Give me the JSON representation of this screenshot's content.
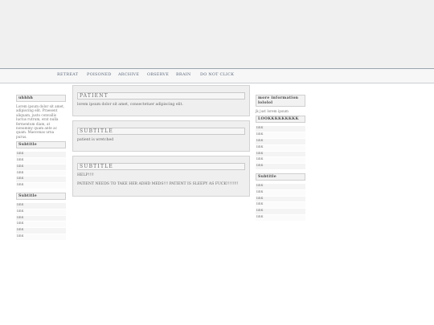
{
  "nav": {
    "items": [
      "RETREAT",
      "POISONED",
      "ARCHIVE",
      "OBSERVE",
      "BRAIN",
      "DO NOT CLICK"
    ]
  },
  "left_sidebar": {
    "block1_title": "uhhhh",
    "block1_text": "Lorem ipsum dolor sit amet, adipiscing elit. Praesent aliquam, justo convallis luctus rutrum, erat nulla fermentum diam, at nonummy quam ante ac quam. Maecenas urna purus.",
    "block2_title": "Subtitle",
    "block2_links": [
      "link",
      "link",
      "link",
      "link",
      "link",
      "link"
    ],
    "block3_title": "Subtitle",
    "block3_links": [
      "link",
      "link",
      "link",
      "link",
      "link",
      "link"
    ]
  },
  "posts": [
    {
      "title": "PATIENT",
      "lines": [
        "lorem ipsum dolor sit amet, consectetuer adipiscing elit."
      ]
    },
    {
      "title": "SUBTITLE",
      "lines": [
        "patient is wretched"
      ]
    },
    {
      "title": "SUBTITLE",
      "lines": [
        "HELP!!!!",
        "PATIENT NEEDS TO TAKE HER ADHD MEDS!!! PATIENT IS SLEEPY AS FUCK!!!!!!!!"
      ]
    }
  ],
  "right_sidebar": {
    "block1_title": "more information lololol",
    "block1_text": "jk just lorem ipsum",
    "block2_title": "LOOKKKKKKKKK",
    "block2_links": [
      "link",
      "link",
      "link",
      "link",
      "link",
      "link",
      "link"
    ],
    "block3_title": "Subtitle",
    "block3_links": [
      "link",
      "link",
      "link",
      "link",
      "link",
      "link"
    ]
  }
}
